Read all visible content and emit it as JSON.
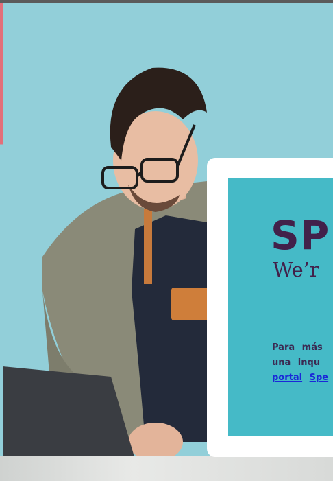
{
  "brand": {
    "name": "SP",
    "tagline": "We’r"
  },
  "info": {
    "line1": "Para más",
    "line2": "una  inqu",
    "link1": "portal",
    "link2": "Spe"
  },
  "colors": {
    "background": "#92cfd9",
    "panel": "#45bac7",
    "brand": "#42214a",
    "link": "#1a28d8"
  }
}
